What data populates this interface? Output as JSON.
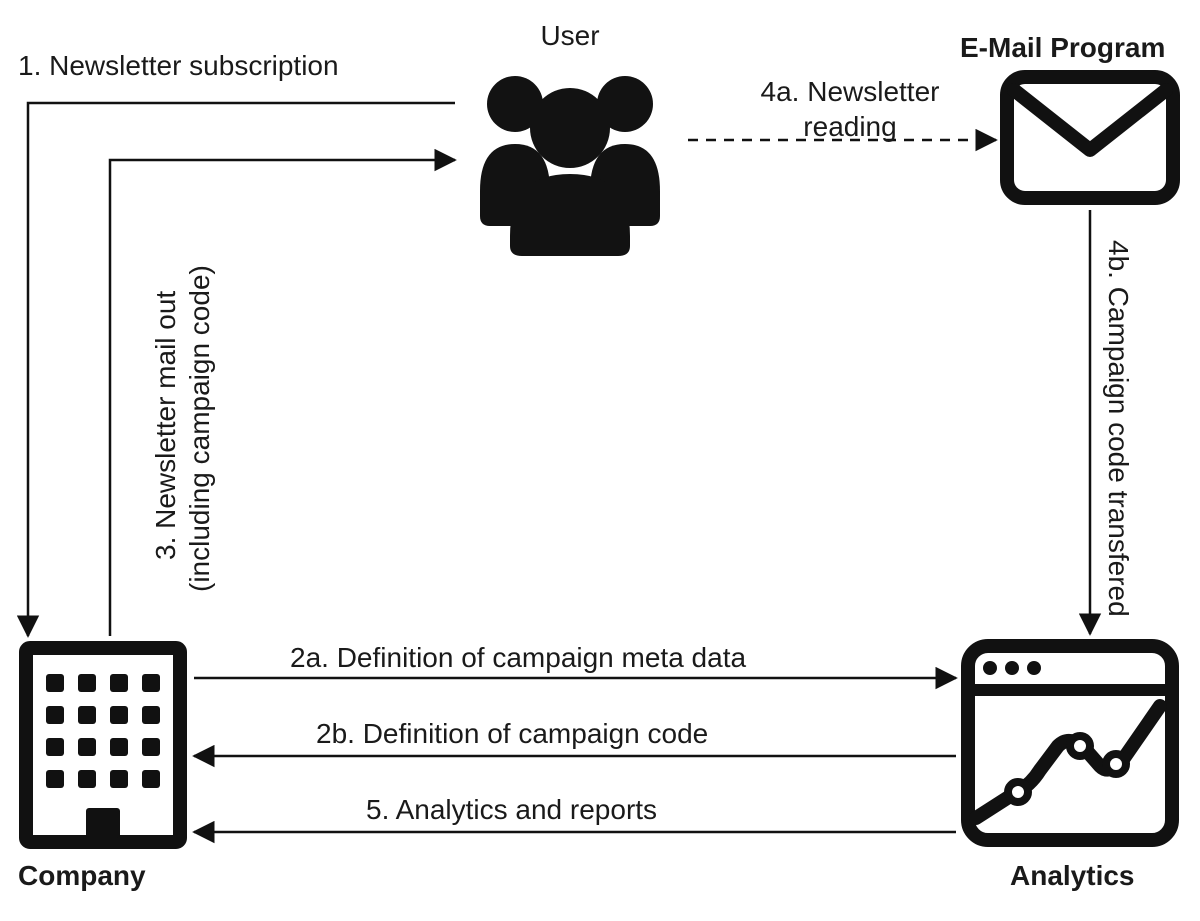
{
  "nodes": {
    "user": {
      "label": "User"
    },
    "email_program": {
      "label": "E-Mail Program"
    },
    "company": {
      "label": "Company"
    },
    "analytics": {
      "label": "Analytics"
    }
  },
  "edges": {
    "e1": {
      "label": "1. Newsletter subscription"
    },
    "e2a": {
      "label": "2a. Definition of campaign meta data"
    },
    "e2b": {
      "label": "2b. Definition of campaign code"
    },
    "e3_line1": "3. Newsletter mail out",
    "e3_line2": "(including campaign code)",
    "e4a_line1": "4a. Newsletter",
    "e4a_line2": "reading",
    "e4b": {
      "label": "4b. Campaign code transfered"
    },
    "e5": {
      "label": "5. Analytics and reports"
    }
  }
}
